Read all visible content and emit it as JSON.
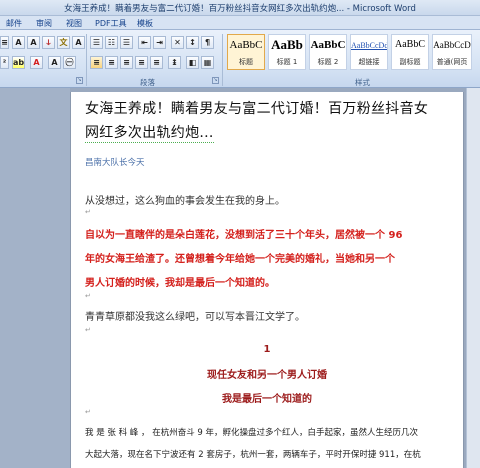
{
  "window": {
    "title": "女海王养成！瞒着男友与富二代订婚！百万粉丝抖音女网红多次出轨约炮... - Microsoft Word"
  },
  "tabs": [
    "邮件",
    "审阅",
    "视图",
    "PDF工具",
    "模板"
  ],
  "ribbon": {
    "paragraph_group_label": "段落",
    "styles_group_label": "样式",
    "styles": [
      {
        "sample": "AaBbC",
        "name": "标题",
        "active": true
      },
      {
        "sample": "AaBb",
        "name": "标题 1",
        "active": false
      },
      {
        "sample": "AaBbC",
        "name": "标题 2",
        "active": false
      },
      {
        "sample": "AaBbCcDd",
        "name": "超链接",
        "active": false
      },
      {
        "sample": "AaBbC",
        "name": "副标题",
        "active": false
      },
      {
        "sample": "AaBbCcD",
        "name": "普通(网页",
        "active": false
      }
    ]
  },
  "document": {
    "headline_line1": "女海王养成！瞒着男友与富二代订婚！百万粉丝抖音女",
    "headline_line2": "网红多次出轨约炮...",
    "author": "昌南大队长今天",
    "para1": "从没想过，这么狗血的事会发生在我的身上。",
    "red_line1": "自以为一直瞎伴的是朵白莲花，没想到活了三十个年头，居然被一个 96",
    "red_line2": "年的女海王给渣了。还曾想着今年给她一个完美的婚礼，当她和另一个",
    "red_line3": "男人订婚的时候，我却是最后一个知道的。",
    "para2": "青青草原都没我这么绿吧，可以写本晋江文学了。",
    "section_number": "1",
    "section_title_line1": "现任女友和另一个男人订婚",
    "section_title_line2": "我是最后一个知道的",
    "body_line1": "我 是 张 科 峰 ， 在杭州奋斗 9 年，孵化操盘过多个红人，白手起家，虽然人生经历几次",
    "body_line2": "大起大落，现在名下宁波还有 2 套房子，杭州一套，两辆车子，平时开保时捷 911，在杭",
    "paragraph_mark": "↵"
  },
  "colors": {
    "accent": "#15428b",
    "red_text": "#d4201c",
    "section_red": "#9c1a1a",
    "author_blue": "#4a6fa8"
  }
}
